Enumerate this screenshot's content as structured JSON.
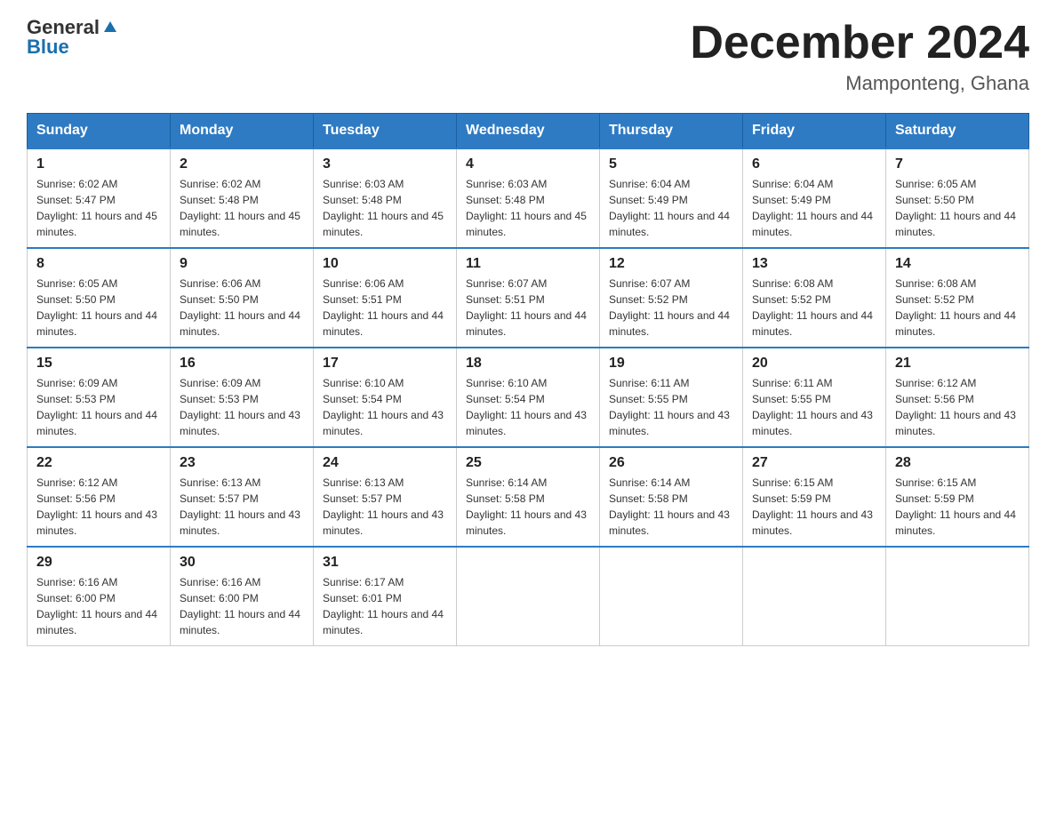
{
  "header": {
    "logo_general": "General",
    "logo_blue": "Blue",
    "month_title": "December 2024",
    "location": "Mamponteng, Ghana"
  },
  "days_of_week": [
    "Sunday",
    "Monday",
    "Tuesday",
    "Wednesday",
    "Thursday",
    "Friday",
    "Saturday"
  ],
  "weeks": [
    [
      {
        "day": "1",
        "sunrise": "6:02 AM",
        "sunset": "5:47 PM",
        "daylight": "11 hours and 45 minutes."
      },
      {
        "day": "2",
        "sunrise": "6:02 AM",
        "sunset": "5:48 PM",
        "daylight": "11 hours and 45 minutes."
      },
      {
        "day": "3",
        "sunrise": "6:03 AM",
        "sunset": "5:48 PM",
        "daylight": "11 hours and 45 minutes."
      },
      {
        "day": "4",
        "sunrise": "6:03 AM",
        "sunset": "5:48 PM",
        "daylight": "11 hours and 45 minutes."
      },
      {
        "day": "5",
        "sunrise": "6:04 AM",
        "sunset": "5:49 PM",
        "daylight": "11 hours and 44 minutes."
      },
      {
        "day": "6",
        "sunrise": "6:04 AM",
        "sunset": "5:49 PM",
        "daylight": "11 hours and 44 minutes."
      },
      {
        "day": "7",
        "sunrise": "6:05 AM",
        "sunset": "5:50 PM",
        "daylight": "11 hours and 44 minutes."
      }
    ],
    [
      {
        "day": "8",
        "sunrise": "6:05 AM",
        "sunset": "5:50 PM",
        "daylight": "11 hours and 44 minutes."
      },
      {
        "day": "9",
        "sunrise": "6:06 AM",
        "sunset": "5:50 PM",
        "daylight": "11 hours and 44 minutes."
      },
      {
        "day": "10",
        "sunrise": "6:06 AM",
        "sunset": "5:51 PM",
        "daylight": "11 hours and 44 minutes."
      },
      {
        "day": "11",
        "sunrise": "6:07 AM",
        "sunset": "5:51 PM",
        "daylight": "11 hours and 44 minutes."
      },
      {
        "day": "12",
        "sunrise": "6:07 AM",
        "sunset": "5:52 PM",
        "daylight": "11 hours and 44 minutes."
      },
      {
        "day": "13",
        "sunrise": "6:08 AM",
        "sunset": "5:52 PM",
        "daylight": "11 hours and 44 minutes."
      },
      {
        "day": "14",
        "sunrise": "6:08 AM",
        "sunset": "5:52 PM",
        "daylight": "11 hours and 44 minutes."
      }
    ],
    [
      {
        "day": "15",
        "sunrise": "6:09 AM",
        "sunset": "5:53 PM",
        "daylight": "11 hours and 44 minutes."
      },
      {
        "day": "16",
        "sunrise": "6:09 AM",
        "sunset": "5:53 PM",
        "daylight": "11 hours and 43 minutes."
      },
      {
        "day": "17",
        "sunrise": "6:10 AM",
        "sunset": "5:54 PM",
        "daylight": "11 hours and 43 minutes."
      },
      {
        "day": "18",
        "sunrise": "6:10 AM",
        "sunset": "5:54 PM",
        "daylight": "11 hours and 43 minutes."
      },
      {
        "day": "19",
        "sunrise": "6:11 AM",
        "sunset": "5:55 PM",
        "daylight": "11 hours and 43 minutes."
      },
      {
        "day": "20",
        "sunrise": "6:11 AM",
        "sunset": "5:55 PM",
        "daylight": "11 hours and 43 minutes."
      },
      {
        "day": "21",
        "sunrise": "6:12 AM",
        "sunset": "5:56 PM",
        "daylight": "11 hours and 43 minutes."
      }
    ],
    [
      {
        "day": "22",
        "sunrise": "6:12 AM",
        "sunset": "5:56 PM",
        "daylight": "11 hours and 43 minutes."
      },
      {
        "day": "23",
        "sunrise": "6:13 AM",
        "sunset": "5:57 PM",
        "daylight": "11 hours and 43 minutes."
      },
      {
        "day": "24",
        "sunrise": "6:13 AM",
        "sunset": "5:57 PM",
        "daylight": "11 hours and 43 minutes."
      },
      {
        "day": "25",
        "sunrise": "6:14 AM",
        "sunset": "5:58 PM",
        "daylight": "11 hours and 43 minutes."
      },
      {
        "day": "26",
        "sunrise": "6:14 AM",
        "sunset": "5:58 PM",
        "daylight": "11 hours and 43 minutes."
      },
      {
        "day": "27",
        "sunrise": "6:15 AM",
        "sunset": "5:59 PM",
        "daylight": "11 hours and 43 minutes."
      },
      {
        "day": "28",
        "sunrise": "6:15 AM",
        "sunset": "5:59 PM",
        "daylight": "11 hours and 44 minutes."
      }
    ],
    [
      {
        "day": "29",
        "sunrise": "6:16 AM",
        "sunset": "6:00 PM",
        "daylight": "11 hours and 44 minutes."
      },
      {
        "day": "30",
        "sunrise": "6:16 AM",
        "sunset": "6:00 PM",
        "daylight": "11 hours and 44 minutes."
      },
      {
        "day": "31",
        "sunrise": "6:17 AM",
        "sunset": "6:01 PM",
        "daylight": "11 hours and 44 minutes."
      },
      null,
      null,
      null,
      null
    ]
  ]
}
